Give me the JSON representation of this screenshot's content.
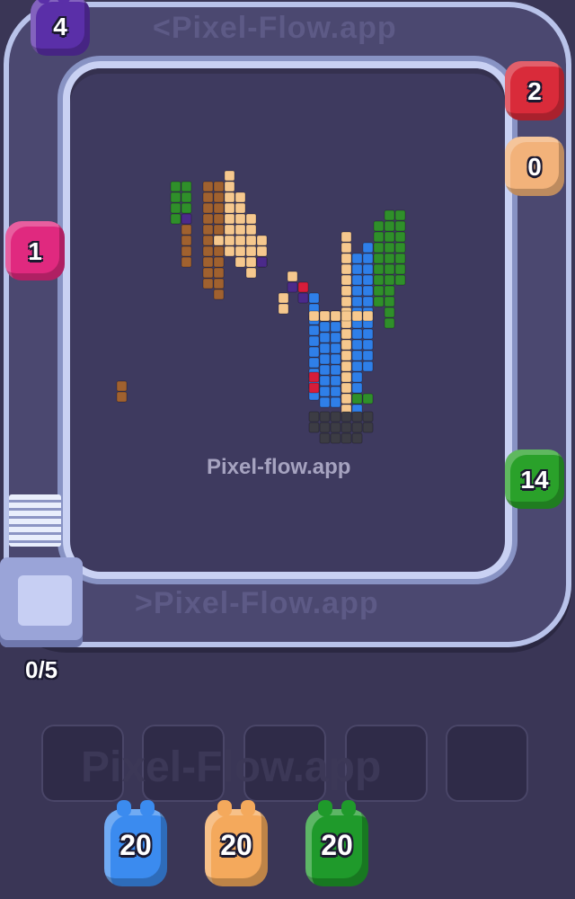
{
  "belt": {
    "watermark_top": "<Pixel-Flow.app",
    "watermark_bottom": ">Pixel-Flow.app"
  },
  "board": {
    "watermark": "Pixel-flow.app"
  },
  "dispenser": {
    "counter": "0/5"
  },
  "belt_shooters": [
    {
      "count": "4",
      "color": "#5a2fa8"
    },
    {
      "count": "2",
      "color": "#d92b3a"
    },
    {
      "count": "0",
      "color": "#f2b27a"
    },
    {
      "count": "1",
      "color": "#e0297f"
    },
    {
      "count": "14",
      "color": "#2aa12a"
    }
  ],
  "slots": {
    "watermark": "Pixel-Flow.app",
    "count": 5
  },
  "queue": [
    {
      "count": "20",
      "color": "#3b8bef"
    },
    {
      "count": "20",
      "color": "#f4a95c"
    },
    {
      "count": "20",
      "color": "#1f9a2b"
    }
  ],
  "palette": {
    "brown": "#a0612f",
    "tan": "#f6c88e",
    "green": "#2f8f2a",
    "blue": "#2f7fe8",
    "purple": "#4b2a8a",
    "red": "#d61d3a",
    "dark": "#3c3c44"
  }
}
